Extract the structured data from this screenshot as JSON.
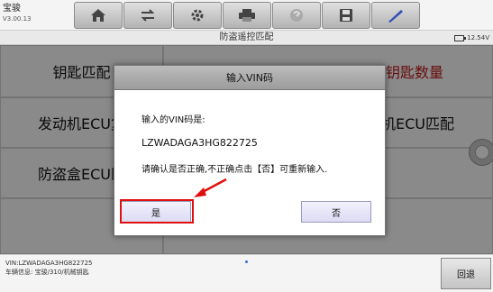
{
  "header": {
    "brand_name": "宝骏",
    "version": "V3.00.13",
    "toolbar": [
      {
        "icon": "home-icon"
      },
      {
        "icon": "swap-icon"
      },
      {
        "icon": "gear-icon"
      },
      {
        "icon": "printer-icon"
      },
      {
        "icon": "help-icon"
      },
      {
        "icon": "save-icon"
      },
      {
        "icon": "pen-icon"
      }
    ]
  },
  "titlebar": {
    "title": "防盗遥控匹配",
    "battery": "12.54V"
  },
  "grid": {
    "left": [
      "钥匙匹配",
      "发动机ECU复",
      "防盗盒ECU匹"
    ],
    "right": [
      "钥匙数量",
      "动机ECU匹配",
      ""
    ]
  },
  "dialog": {
    "title": "输入VIN码",
    "label": "输入的VIN码是:",
    "vin": "LZWADAGA3HG822725",
    "confirm_text": "请确认是否正确,不正确点击【否】可重新输入.",
    "yes_label": "是",
    "no_label": "否"
  },
  "footer": {
    "vin_line": "VIN:LZWADAGA3HG822725",
    "info_line": "车辆信息: 宝骏/310/机械钥匙",
    "back_label": "回退"
  },
  "colors": {
    "highlight": "#e01010",
    "accent_red": "#c01818"
  }
}
